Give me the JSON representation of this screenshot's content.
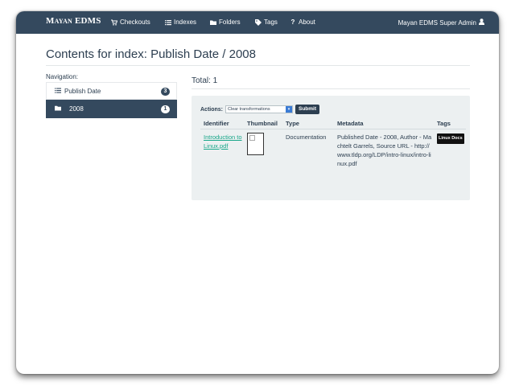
{
  "navbar": {
    "brand": "Mayan EDMS",
    "items": [
      {
        "label": "Checkouts",
        "icon": "cart-icon"
      },
      {
        "label": "Indexes",
        "icon": "list-icon"
      },
      {
        "label": "Folders",
        "icon": "folder-icon"
      },
      {
        "label": "Tags",
        "icon": "tag-icon"
      },
      {
        "label": "About",
        "icon": "question-icon"
      }
    ],
    "user": "Mayan EDMS Super Admin"
  },
  "page": {
    "title": "Contents for index: Publish Date / 2008"
  },
  "navigation": {
    "label": "Navigation:",
    "items": [
      {
        "label": "Publish Date",
        "count": "3",
        "icon": "list-icon"
      },
      {
        "label": "2008",
        "count": "1",
        "icon": "folder-icon",
        "active": true
      }
    ]
  },
  "results": {
    "total": "Total: 1",
    "actions_label": "Actions:",
    "select_value": "Clear transformations",
    "submit_label": "Submit",
    "columns": [
      "Identifier",
      "Thumbnail",
      "Type",
      "Metadata",
      "Tags"
    ],
    "rows": [
      {
        "identifier": "Introduction to Linux.pdf",
        "type": "Documentation",
        "metadata": "Published Date - 2008, Author - Machtelt Garrels, Source URL - http://www.tldp.org/LDP/intro-linux/intro-linux.pdf",
        "tag": "Linux Docs"
      }
    ]
  },
  "colors": {
    "navbar": "#34495e",
    "link": "#18a689",
    "panel": "#ecf0f1"
  }
}
